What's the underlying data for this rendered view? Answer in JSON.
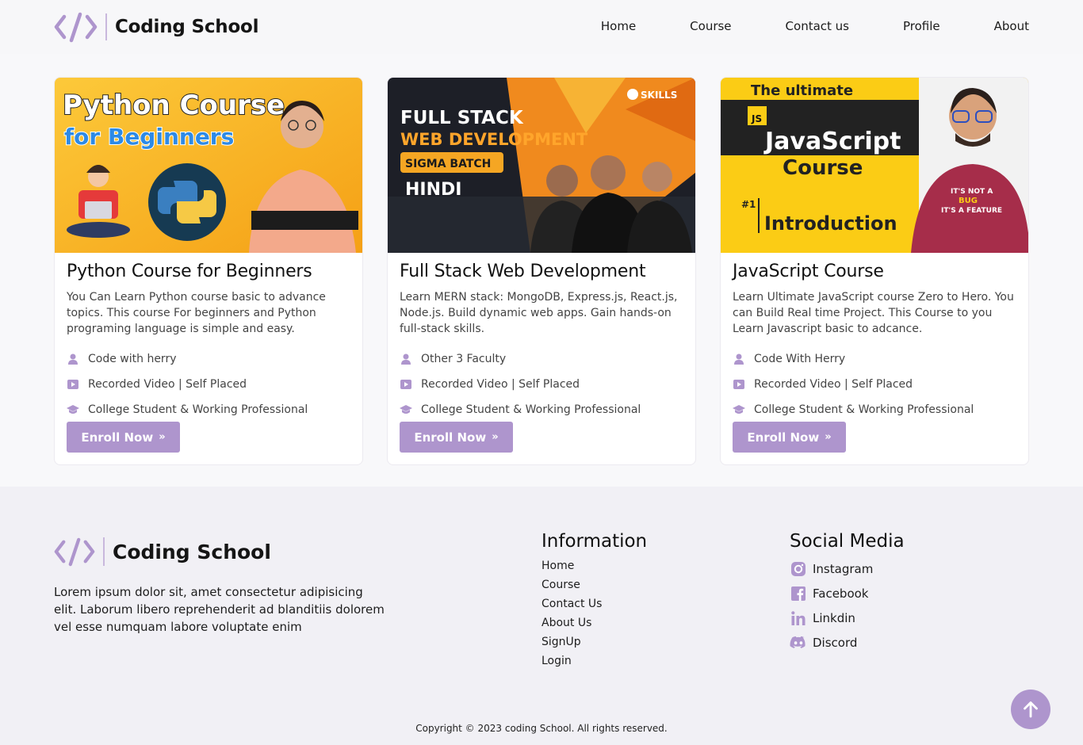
{
  "brand": {
    "name": "Coding School",
    "accent": "#ae95cd"
  },
  "nav": {
    "items": [
      "Home",
      "Course",
      "Contact us",
      "Profile",
      "About"
    ]
  },
  "courses": [
    {
      "title": "Python Course for Beginners",
      "description": "You Can Learn Python course basic to advance topics. This course For beginners and Python programing language is simple and easy.",
      "instructor": "Code with herry",
      "mode": "Recorded Video | Self Placed",
      "audience": "College Student & Working Professional",
      "enroll_label": "Enroll Now",
      "thumb": {
        "line1": "Python Course",
        "line2": "for Beginners",
        "bg": "#f9b32a"
      }
    },
    {
      "title": "Full Stack Web Development",
      "description": "Learn MERN stack: MongoDB, Express.js, React.js, Node.js. Build dynamic web apps. Gain hands-on full-stack skills.",
      "instructor": "Other 3 Faculty",
      "mode": "Recorded Video | Self Placed",
      "audience": "College Student & Working Professional",
      "enroll_label": "Enroll Now",
      "thumb": {
        "line1": "FULL STACK",
        "line2": "WEB DEVELOPMENT",
        "badge": "SIGMA BATCH",
        "lang": "HINDI",
        "logo": "SKILLS",
        "bg": "#f08a1e"
      }
    },
    {
      "title": "JavaScript Course",
      "description": "Learn Ultimate JavaScript course Zero to Hero. You can Build Real time Project. This Course to you Learn Javascript basic to adcance.",
      "instructor": "Code With Herry",
      "mode": "Recorded Video | Self Placed",
      "audience": "College Student & Working Professional",
      "enroll_label": "Enroll Now",
      "thumb": {
        "top": "The ultimate",
        "js": "JS",
        "line1": "JavaScript",
        "line2": "Course",
        "num": "#1",
        "intro": "Introduction",
        "shirt1": "IT'S NOT A",
        "shirt2": "BUG",
        "shirt3": "IT'S A FEATURE",
        "bg": "#fbcc15"
      }
    }
  ],
  "footer": {
    "brand": "Coding School",
    "about": "Lorem ipsum dolor sit, amet consectetur adipisicing elit. Laborum libero reprehenderit ad blanditiis dolorem vel esse numquam labore voluptate enim",
    "info_title": "Information",
    "info_links": [
      "Home",
      "Course",
      "Contact Us",
      "About Us",
      "SignUp",
      "Login"
    ],
    "social_title": "Social Media",
    "social_links": [
      {
        "label": "Instagram",
        "icon": "instagram-icon"
      },
      {
        "label": "Facebook",
        "icon": "facebook-icon"
      },
      {
        "label": "Linkdin",
        "icon": "linkedin-icon"
      },
      {
        "label": "Discord",
        "icon": "discord-icon"
      }
    ],
    "copyright": "Copyright © 2023 coding School. All rights reserved."
  }
}
